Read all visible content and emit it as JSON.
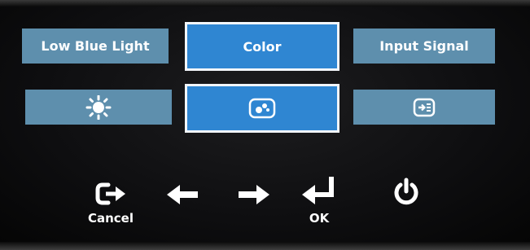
{
  "osd": {
    "menu_tabs": [
      {
        "label": "Low Blue Light",
        "selected": false
      },
      {
        "label": "Color",
        "selected": true
      },
      {
        "label": "Input Signal",
        "selected": false
      }
    ],
    "icon_tiles": [
      {
        "icon": "brightness-sun-icon",
        "selected": false
      },
      {
        "icon": "color-palette-icon",
        "selected": true
      },
      {
        "icon": "input-source-icon",
        "selected": false
      }
    ],
    "colors": {
      "tile": "#5e8fad",
      "tile_selected": "#2f86d2",
      "selected_border": "#f2f6fa"
    }
  },
  "keys": {
    "cancel": {
      "label": "Cancel",
      "icon": "exit-icon"
    },
    "left": {
      "icon": "arrow-left-icon"
    },
    "right": {
      "icon": "arrow-right-icon"
    },
    "ok": {
      "label": "OK",
      "icon": "enter-icon"
    },
    "power": {
      "icon": "power-icon"
    }
  }
}
